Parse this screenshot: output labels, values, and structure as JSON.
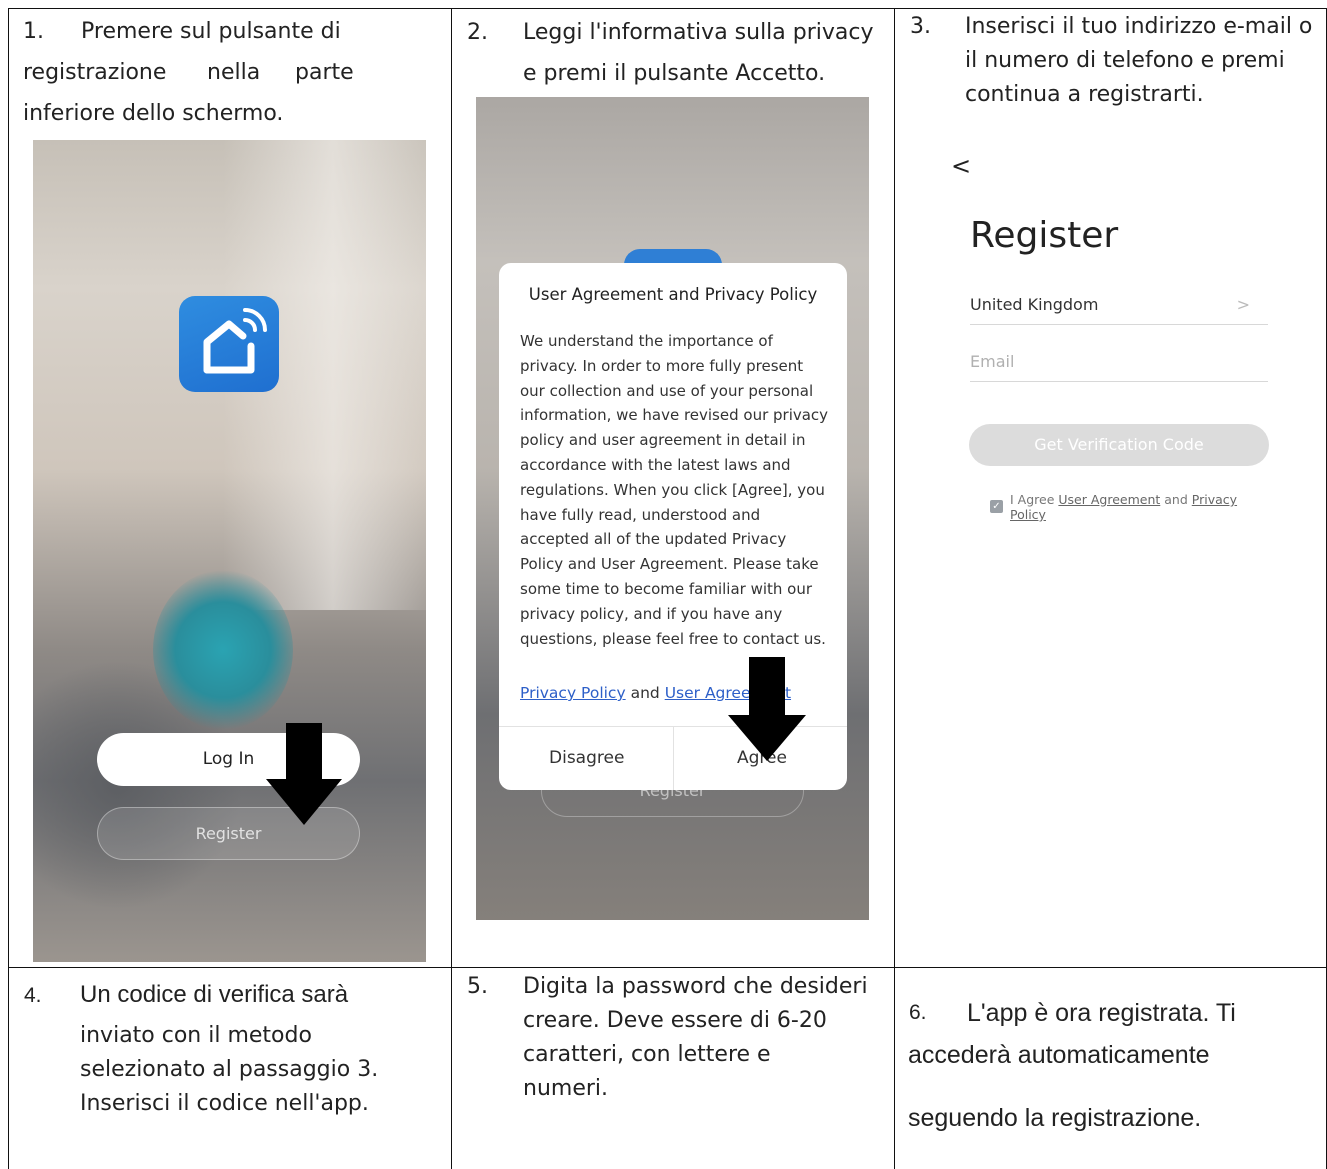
{
  "steps": {
    "s1": {
      "num": "1.",
      "text": [
        "Premere sul pulsante di",
        "registrazione",
        "nella",
        "parte",
        "inferiore dello schermo."
      ],
      "app": {
        "login": "Log In",
        "register": "Register"
      }
    },
    "s2": {
      "num": "2.",
      "text": [
        "Leggi l'informativa sulla privacy",
        "e premi il pulsante Accetto."
      ],
      "dialog": {
        "title": "User Agreement and Privacy Policy",
        "body": "We understand the importance of privacy. In order to more fully present our collection and use of your personal information, we have revised our privacy policy and user agreement in detail in accordance with the latest laws and regulations. When you click [Agree], you have fully read, understood and accepted all of the updated Privacy Policy and User Agreement. Please take some time to become familiar with our privacy policy, and if you have any questions, please feel free to contact us.",
        "link_privacy": "Privacy Policy",
        "link_and": "and",
        "link_user": "User Agreement",
        "disagree": "Disagree",
        "agree": "Agree"
      },
      "bg_register": "Register"
    },
    "s3": {
      "num": "3.",
      "text": [
        "Inserisci il tuo indirizzo e-mail o",
        "il numero di telefono e premi",
        "continua a registrarti."
      ],
      "app": {
        "back": "<",
        "title": "Register",
        "country": "United Kingdom",
        "country_chevron": ">",
        "email_placeholder": "Email",
        "get_code": "Get Verification Code",
        "agree_prefix": "I Agree",
        "agree_link1": "User Agreement",
        "agree_and": "and",
        "agree_link2": "Privacy Policy"
      }
    },
    "s4": {
      "num": "4.",
      "text": [
        "Un codice di verifica sarà",
        "inviato con il metodo",
        "selezionato al passaggio 3.",
        "Inserisci il codice nell'app."
      ]
    },
    "s5": {
      "num": "5.",
      "text": [
        "Digita la password che desideri",
        "creare. Deve essere di 6-20",
        "caratteri, con lettere e",
        "numeri."
      ]
    },
    "s6": {
      "num": "6.",
      "text": [
        "L'app è ora registrata. Ti",
        "accederà automaticamente",
        "seguendo la registrazione."
      ]
    }
  }
}
